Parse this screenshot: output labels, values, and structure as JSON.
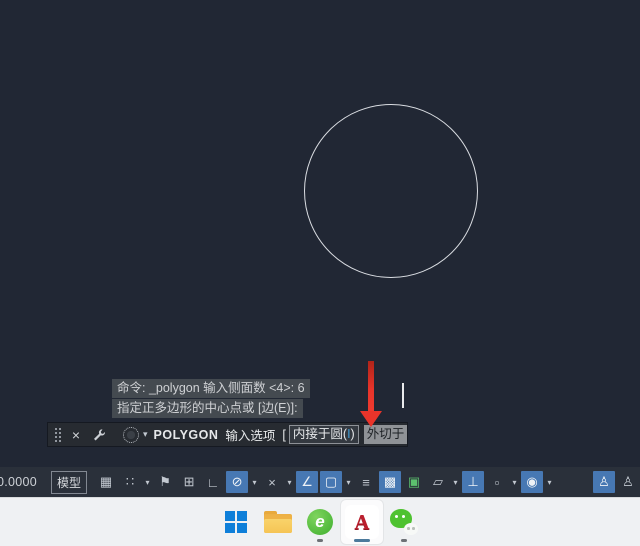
{
  "ui": {
    "caret_glyph": "▾",
    "close_glyph": "×",
    "colors": {
      "accent_blue": "#4778b3",
      "arrow_red": "#ea342a",
      "canvas_bg": "#212734",
      "taskbar_bg": "#eff1f3"
    }
  },
  "canvas": {
    "history_line1": "命令: _polygon 输入侧面数 <4>: 6",
    "history_line2": "指定正多边形的中心点或 [边(E)]:"
  },
  "command_bar": {
    "command": "POLYGON",
    "prompt": "输入选项",
    "open_bracket": "[",
    "option_inscribed_pre": "内接于圆(",
    "option_inscribed_key": "I",
    "option_inscribed_post": ")",
    "option_circumscribed": "外切于"
  },
  "status_bar": {
    "coordinates": "0.0000",
    "model_button": "模型",
    "icons": [
      {
        "name": "grid-icon",
        "glyph": "▦",
        "active": false
      },
      {
        "name": "snap-mode-icon",
        "glyph": "∷",
        "active": false
      },
      {
        "name": "infer-constraints-icon",
        "glyph": "⚑",
        "active": false
      },
      {
        "name": "dynamic-input-icon",
        "glyph": "⊞",
        "active": false
      },
      {
        "name": "ortho-mode-icon",
        "glyph": "∟",
        "active": false
      },
      {
        "name": "polar-tracking-icon",
        "glyph": "⊘",
        "active": true
      },
      {
        "name": "osnap-tracking-icon",
        "glyph": "×",
        "active": false
      },
      {
        "name": "object-snap-angle-icon",
        "glyph": "∠",
        "active": true
      },
      {
        "name": "object-snap-icon",
        "glyph": "▢",
        "active": true
      },
      {
        "name": "lineweight-icon",
        "glyph": "≡",
        "active": false
      },
      {
        "name": "transparency-icon",
        "glyph": "▩",
        "active": true
      },
      {
        "name": "selection-cycling-icon",
        "glyph": "▣",
        "active": false
      },
      {
        "name": "osnap-3d-icon",
        "glyph": "▱",
        "active": false
      },
      {
        "name": "dynamic-ucs-icon",
        "glyph": "⊥",
        "active": true
      },
      {
        "name": "annotation-scale-icon",
        "glyph": "▫",
        "active": false
      },
      {
        "name": "gizmo-icon",
        "glyph": "◉",
        "active": true
      },
      {
        "name": "annotation-visibility-icon",
        "glyph": "♙",
        "active": true
      },
      {
        "name": "autoscale-icon",
        "glyph": "♙",
        "active": false
      }
    ]
  },
  "taskbar": {
    "browser_letter": "e",
    "autocad_letter": "A"
  }
}
